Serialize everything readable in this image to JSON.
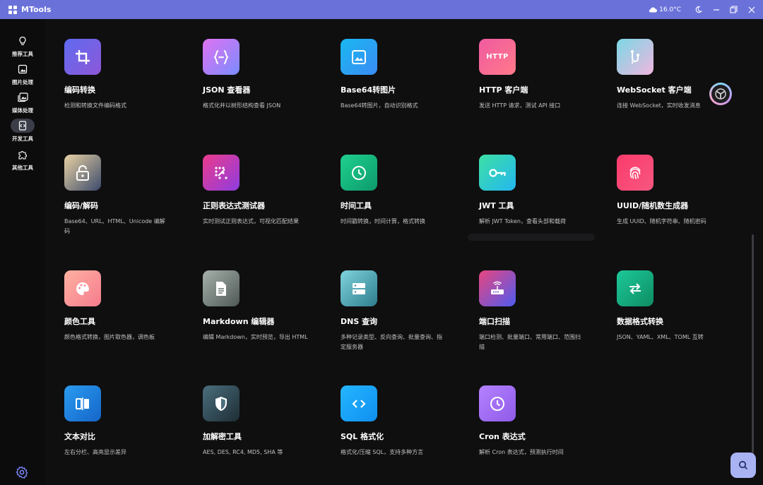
{
  "app": {
    "title": "MTools"
  },
  "weather": {
    "temp": "16.0°C"
  },
  "sidebar": {
    "items": [
      {
        "label": "推荐工具",
        "icon": "lightbulb-icon"
      },
      {
        "label": "图片处理",
        "icon": "image-icon"
      },
      {
        "label": "媒体处理",
        "icon": "media-icon"
      },
      {
        "label": "开发工具",
        "icon": "dev-tools-icon",
        "active": true
      },
      {
        "label": "其他工具",
        "icon": "puzzle-icon"
      }
    ]
  },
  "tools": [
    {
      "title": "编码转换",
      "desc": "检测和转换文件编码格式",
      "icon": "crop-icon"
    },
    {
      "title": "JSON 查看器",
      "desc": "格式化并以树形结构查看 JSON",
      "icon": "braces-icon"
    },
    {
      "title": "Base64转图片",
      "desc": "Base64转图片，自动识别格式",
      "icon": "picture-icon"
    },
    {
      "title": "HTTP 客户端",
      "desc": "发送 HTTP 请求，测试 API 接口",
      "icon": "http-icon",
      "icon_text": "HTTP"
    },
    {
      "title": "WebSocket 客户端",
      "desc": "连接 WebSocket，实时收发消息",
      "icon": "websocket-icon"
    },
    {
      "title": "编码/解码",
      "desc": "Base64、URL、HTML、Unicode 编解码",
      "icon": "lock-icon"
    },
    {
      "title": "正则表达式测试器",
      "desc": "实时测试正则表达式，可视化匹配结果",
      "icon": "regex-icon"
    },
    {
      "title": "时间工具",
      "desc": "时间戳转换，时间计算，格式转换",
      "icon": "clock-icon"
    },
    {
      "title": "JWT 工具",
      "desc": "解析 JWT Token，查看头部和载荷",
      "icon": "key-icon"
    },
    {
      "title": "UUID/随机数生成器",
      "desc": "生成 UUID、随机字符串、随机密码",
      "icon": "fingerprint-icon"
    },
    {
      "title": "颜色工具",
      "desc": "颜色格式转换，图片取色器，调色板",
      "icon": "palette-icon"
    },
    {
      "title": "Markdown 编辑器",
      "desc": "编辑 Markdown，实时预览，导出 HTML",
      "icon": "document-icon"
    },
    {
      "title": "DNS 查询",
      "desc": "多种记录类型、反向查询、批量查询、指定服务器",
      "icon": "dns-icon"
    },
    {
      "title": "端口扫描",
      "desc": "端口检测、批量端口、常用端口、范围扫描",
      "icon": "router-icon"
    },
    {
      "title": "数据格式转换",
      "desc": "JSON、YAML、XML、TOML 互转",
      "icon": "swap-icon"
    },
    {
      "title": "文本对比",
      "desc": "左右分栏、高亮显示差异",
      "icon": "compare-icon"
    },
    {
      "title": "加解密工具",
      "desc": "AES, DES, RC4, MD5, SHA 等",
      "icon": "shield-icon"
    },
    {
      "title": "SQL 格式化",
      "desc": "格式化/压缩 SQL，支持多种方言",
      "icon": "code-icon"
    },
    {
      "title": "Cron 表达式",
      "desc": "解析 Cron 表达式，预测执行时间",
      "icon": "schedule-icon"
    }
  ],
  "colors": {
    "titlebar": "#6a72d9",
    "background": "#0f0f10",
    "fab": "#a9b3f4"
  }
}
